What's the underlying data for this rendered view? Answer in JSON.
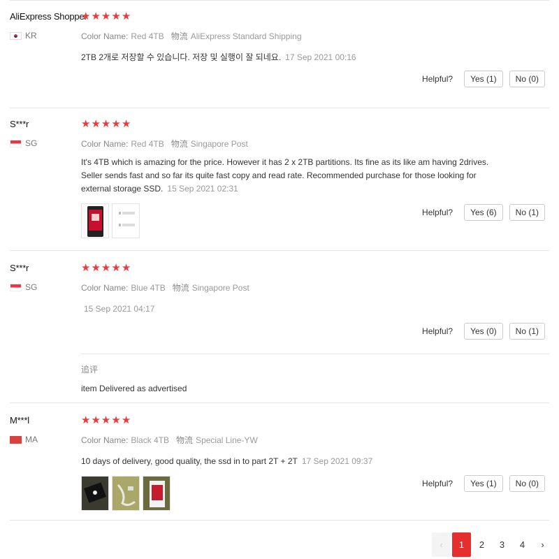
{
  "reviews": [
    {
      "user": "AliExpress Shopper",
      "country_code": "KR",
      "color_label": "Color Name:",
      "color_value": "Red 4TB",
      "ship_label": "物流",
      "ship_value": "AliExpress Standard Shipping",
      "text": "2TB 2개로 저장할 수 있습니다. 저장 및 실행이 잘 되네요.",
      "date": "17 Sep 2021 00:16",
      "helpful_label": "Helpful?",
      "yes": "Yes (1)",
      "no": "No (0)"
    },
    {
      "user": "S***r",
      "country_code": "SG",
      "color_label": "Color Name:",
      "color_value": "Red 4TB",
      "ship_label": "物流",
      "ship_value": "Singapore Post",
      "text": "It's 4TB which is amazing for the price. However it has 2 x 2TB partitions. Its fine as its like am having 2drives. Seller sends fast and so far its quite fast copy and read rate. Recommended purchase for those looking for external storage SSD.",
      "date": "15 Sep 2021 02:31",
      "helpful_label": "Helpful?",
      "yes": "Yes (6)",
      "no": "No (1)"
    },
    {
      "user": "S***r",
      "country_code": "SG",
      "color_label": "Color Name:",
      "color_value": "Blue 4TB",
      "ship_label": "物流",
      "ship_value": "Singapore Post",
      "text": "",
      "date": "15 Sep 2021 04:17",
      "helpful_label": "Helpful?",
      "yes": "Yes (0)",
      "no": "No (1)",
      "followup_label": "追评",
      "followup_text": "item Delivered as advertised"
    },
    {
      "user": "M***l",
      "country_code": "MA",
      "color_label": "Color Name:",
      "color_value": "Black 4TB",
      "ship_label": "物流",
      "ship_value": "Special Line-YW",
      "text": "10 days of delivery, good quality, the ssd in to part 2T + 2T",
      "date": "17 Sep 2021 09:37",
      "helpful_label": "Helpful?",
      "yes": "Yes (1)",
      "no": "No (0)"
    }
  ],
  "rating_stars": "★",
  "pagination": {
    "prev": "‹",
    "pages": [
      "1",
      "2",
      "3",
      "4"
    ],
    "next": "›",
    "active": "1"
  },
  "colors": {
    "accent": "#e62e2e",
    "star": "#ee3a3a"
  }
}
